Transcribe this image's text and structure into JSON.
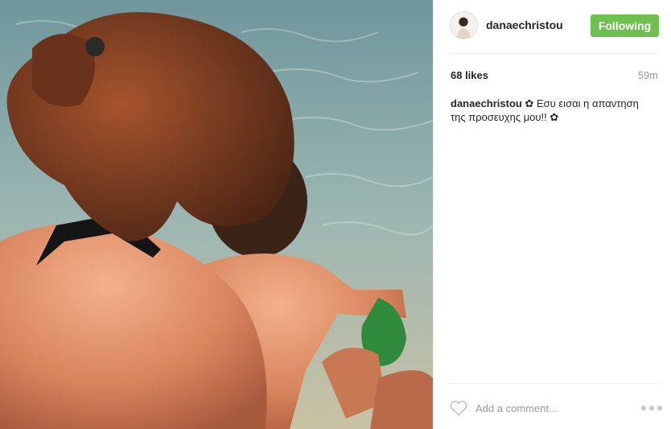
{
  "post": {
    "username": "danaechristou",
    "follow_label": "Following",
    "likes": "68 likes",
    "time": "59m",
    "caption_user": "danaechristou",
    "caption_text": " ✿ Εσυ εισαι η απαντηση της προσευχης μου!! ✿",
    "comment_placeholder": "Add a comment..."
  },
  "colors": {
    "follow_button": "#70c050",
    "text": "#262626",
    "muted": "#999999"
  },
  "icons": {
    "like": "heart-icon",
    "more": "more-options-icon"
  }
}
